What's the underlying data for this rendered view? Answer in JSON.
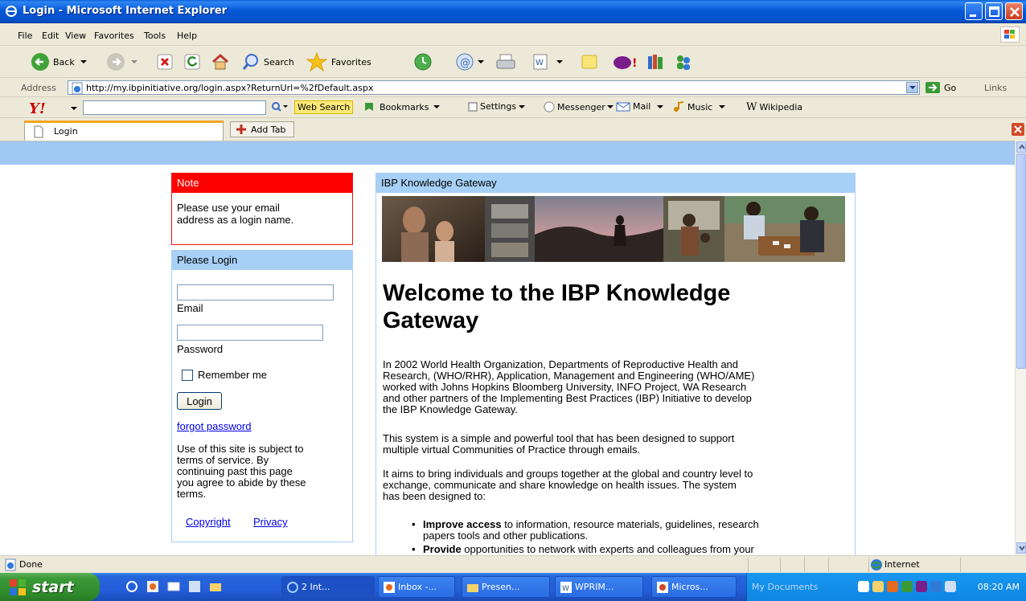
{
  "window": {
    "title": "Login - Microsoft Internet Explorer"
  },
  "menu": [
    "File",
    "Edit",
    "View",
    "Favorites",
    "Tools",
    "Help"
  ],
  "toolbar": {
    "back": "Back",
    "search": "Search",
    "favorites": "Favorites"
  },
  "address": {
    "label": "Address",
    "url": "http://my.ibpinitiative.org/login.aspx?ReturnUrl=%2fDefault.aspx",
    "go": "Go",
    "links": "Links"
  },
  "yahoo": {
    "logo": "Y!",
    "web_search": "Web Search",
    "bookmarks": "Bookmarks",
    "settings": "Settings",
    "messenger": "Messenger",
    "mail": "Mail",
    "music": "Music",
    "wikipedia": "Wikipedia"
  },
  "tabs": {
    "active": "Login",
    "add": "Add Tab"
  },
  "note": {
    "header": "Note",
    "line1": "Please use your email",
    "line2": "address as a login name."
  },
  "login": {
    "header": "Please Login",
    "email_label": "Email",
    "email_value": "",
    "password_label": "Password",
    "remember": "Remember me",
    "button": "Login",
    "forgot": "forgot password",
    "terms": [
      "Use of this site is subject to",
      "terms of service. By",
      "continuing past this page",
      "you agree to abide by these",
      "terms."
    ],
    "copyright": "Copyright",
    "privacy": "Privacy"
  },
  "gateway": {
    "header": "IBP Knowledge Gateway",
    "title_line1": "Welcome to the IBP Knowledge",
    "title_line2": "Gateway",
    "p1": [
      "In 2002 World Health Organization, Departments of Reproductive Health and",
      "Research, (WHO/RHR), Application, Management and Engineering (WHO/AME)",
      "worked with Johns Hopkins Bloomberg University, INFO Project, WA Research",
      "and other partners of the Implementing Best Practices (IBP) Initiative to develop",
      "the IBP Knowledge Gateway."
    ],
    "p2": [
      "This system is a simple and powerful tool that has been designed to support",
      "multiple virtual Communities of Practice through emails."
    ],
    "p3": [
      "It aims to bring individuals and groups together at the global and country level to",
      "exchange, communicate and share knowledge on health issues.  The system",
      "has been designed to:"
    ],
    "bullets": [
      {
        "bold": "Improve access",
        "rest1": " to information, resource materials, guidelines, research",
        "rest2": "papers tools and other publications."
      },
      {
        "bold": "Provide",
        "rest1": " opportunities to network with experts and colleagues from your",
        "rest2": ""
      }
    ]
  },
  "status": {
    "left": "Done",
    "zone": "Internet"
  },
  "taskbar": {
    "start": "start",
    "tasks": [
      "2 Int...",
      "Inbox -...",
      "Presen...",
      "WPRIM...",
      "Micros..."
    ],
    "my_documents": "My Documents",
    "clock": "08:20 AM"
  }
}
